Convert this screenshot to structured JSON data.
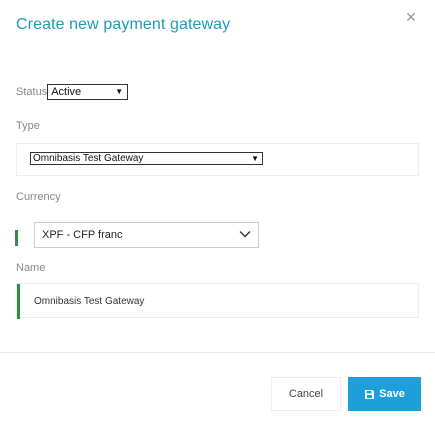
{
  "dialog": {
    "title": "Create new payment gateway",
    "close_icon": "close-icon"
  },
  "form": {
    "status": {
      "label": "Status",
      "value": "Active"
    },
    "type": {
      "label": "Type",
      "value": "Omnibasis Test Gateway"
    },
    "currency": {
      "label": "Currency",
      "value": "XPF - CFP franc"
    },
    "name": {
      "label": "Name",
      "value": "Omnibasis Test Gateway"
    }
  },
  "footer": {
    "cancel_label": "Cancel",
    "save_label": "Save",
    "save_icon": "floppy-disk-icon"
  },
  "colors": {
    "title": "#1e9bb3",
    "accent_green": "#2f8f46",
    "save_button": "#1f9fd9"
  }
}
